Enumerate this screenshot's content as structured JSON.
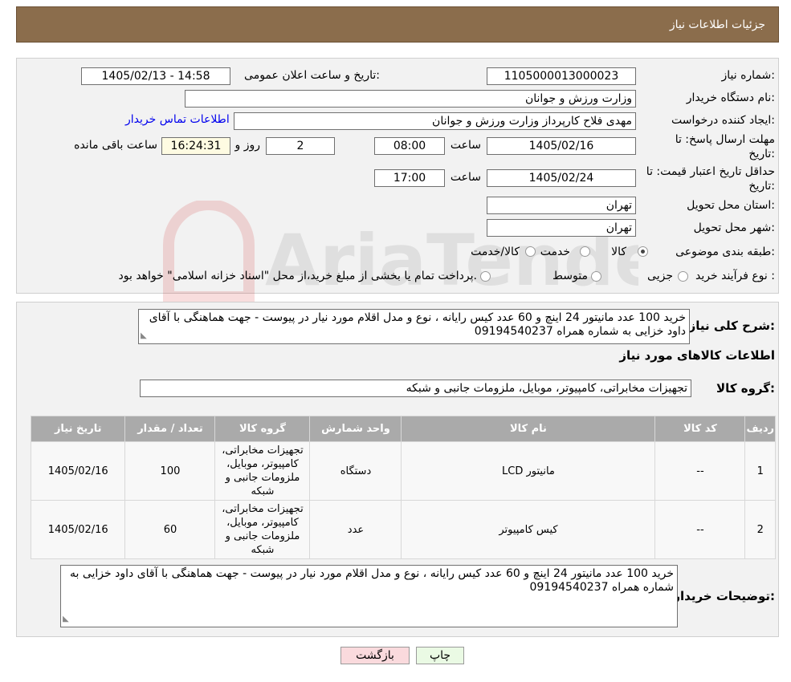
{
  "header": {
    "title": "جزئیات اطلاعات نیاز"
  },
  "form": {
    "need_number_label": "شماره نیاز:",
    "need_number": "1105000013000023",
    "announce_label": "تاریخ و ساعت اعلان عمومی:",
    "announce_value": "1405/02/13 - 14:58",
    "buyer_org_label": "نام دستگاه خریدار:",
    "buyer_org": "وزارت ورزش و جوانان",
    "creator_label": "ایجاد کننده درخواست:",
    "creator": "مهدی فلاح کارپرداز وزارت ورزش و جوانان",
    "contact_link": "اطلاعات تماس خریدار",
    "reply_deadline_label": "مهلت ارسال پاسخ: تا تاریخ:",
    "reply_date": "1405/02/16",
    "time_label": "ساعت",
    "reply_time": "08:00",
    "days_value": "2",
    "days_label": "روز و",
    "remaining_time": "16:24:31",
    "remaining_label": "ساعت باقی مانده",
    "price_validity_label": "حداقل تاریخ اعتبار قیمت: تا تاریخ:",
    "price_date": "1405/02/24",
    "price_time": "17:00",
    "province_label": "استان محل تحویل:",
    "province": "تهران",
    "city_label": "شهر محل تحویل:",
    "city": "تهران",
    "category_label": "طبقه بندی موضوعی:",
    "category_options": [
      "کالا",
      "خدمت",
      "کالا/خدمت"
    ],
    "process_label": "نوع فرآیند خرید :",
    "process_options": [
      "جزیی",
      "متوسط"
    ],
    "process_note": "پرداخت تمام یا بخشی از مبلغ خرید،از محل \"اسناد خزانه اسلامی\" خواهد بود."
  },
  "details": {
    "summary_label": "شرح کلی نیاز:",
    "summary": "خرید 100 عدد مانیتور 24 اینچ و 60 عدد کیس رایانه  ، نوع و مدل اقلام مورد نیار در پیوست - جهت هماهنگی با آقای داود خزایی  به شماره همراه 09194540237",
    "items_title": "اطلاعات کالاهای مورد نیاز",
    "group_label": "گروه کالا:",
    "group_value": "تجهیزات مخابراتی، کامپیوتر، موبایل، ملزومات جانبی و شبکه",
    "table": {
      "headers": [
        "ردیف",
        "کد کالا",
        "نام کالا",
        "واحد شمارش",
        "گروه کالا",
        "تعداد / مقدار",
        "تاریخ نیاز"
      ],
      "rows": [
        [
          "1",
          "--",
          "مانیتور LCD",
          "دستگاه",
          "تجهیزات مخابراتی، کامپیوتر، موبایل، ملزومات جانبی و شبکه",
          "100",
          "1405/02/16"
        ],
        [
          "2",
          "--",
          "کیس کامپیوتر",
          "عدد",
          "تجهیزات مخابراتی، کامپیوتر، موبایل، ملزومات جانبی و شبکه",
          "60",
          "1405/02/16"
        ]
      ]
    },
    "buyer_notes_label": "توضیحات خریدار:",
    "buyer_notes": "خرید 100 عدد مانیتور 24 اینچ و 60 عدد کیس رایانه  ، نوع و مدل اقلام مورد نیار در پیوست - جهت هماهنگی با آقای داود خزایی  به شماره همراه 09194540237"
  },
  "buttons": {
    "print": "چاپ",
    "back": "بازگشت"
  },
  "watermark": {
    "text": "AriaTender.neT"
  },
  "colors": {
    "header_bg": "#8b6d4c",
    "table_header_bg": "#aaaaaa",
    "back_button_bg": "#fadadd",
    "print_button_bg": "#eafae4"
  }
}
